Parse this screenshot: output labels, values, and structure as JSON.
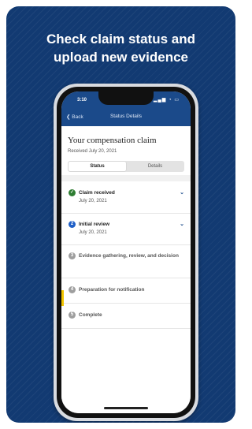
{
  "headline": {
    "line1": "Check claim status and",
    "line2": "upload new evidence"
  },
  "status_bar": {
    "time": "3:10"
  },
  "nav": {
    "back_label": "Back",
    "title": "Status Details"
  },
  "claim": {
    "title": "Your compensation claim",
    "received": "Received July 20, 2021"
  },
  "tabs": {
    "status": "Status",
    "details": "Details",
    "active": "Status"
  },
  "steps": [
    {
      "number": "",
      "label": "Claim received",
      "date": "July 20, 2021",
      "state": "complete"
    },
    {
      "number": "2",
      "label": "Initial review",
      "date": "July 20, 2021",
      "state": "current"
    },
    {
      "number": "3",
      "label": "Evidence gathering, review, and decision",
      "date": "",
      "state": "pending"
    },
    {
      "number": "4",
      "label": "Preparation for notification",
      "date": "",
      "state": "pending"
    },
    {
      "number": "5",
      "label": "Complete",
      "date": "",
      "state": "pending"
    }
  ],
  "colors": {
    "background": "#123a72",
    "nav": "#1b4a8a",
    "complete": "#2e7d32",
    "current": "#1f5fc7",
    "pending": "#9e9e9e",
    "alert": "#f2c500"
  },
  "icons": {
    "back": "chevron-left-icon",
    "complete": "check-circle-icon",
    "expand": "chevron-down-icon"
  }
}
